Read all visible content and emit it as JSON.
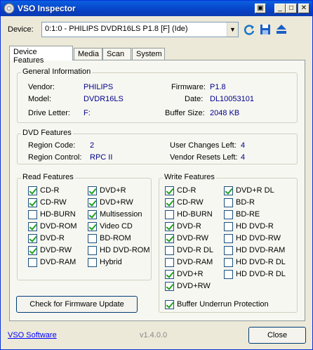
{
  "window": {
    "title": "VSO Inspector"
  },
  "device": {
    "label": "Device:",
    "selected": "0:1:0 - PHILIPS DVDR16LS P1.8 [F] (Ide)"
  },
  "tabs": [
    {
      "label": "Device Features"
    },
    {
      "label": "Media"
    },
    {
      "label": "Scan"
    },
    {
      "label": "System"
    }
  ],
  "general": {
    "title": "General Information",
    "vendor_label": "Vendor:",
    "vendor": "PHILIPS",
    "model_label": "Model:",
    "model": "DVDR16LS",
    "drive_letter_label": "Drive Letter:",
    "drive_letter": "F:",
    "firmware_label": "Firmware:",
    "firmware": "P1.8",
    "date_label": "Date:",
    "date": "DL10053101",
    "buffer_label": "Buffer Size:",
    "buffer": "2048 KB"
  },
  "dvd": {
    "title": "DVD Features",
    "region_code_label": "Region Code:",
    "region_code": "2",
    "region_control_label": "Region Control:",
    "region_control": "RPC II",
    "user_changes_label": "User Changes Left:",
    "user_changes": "4",
    "vendor_resets_label": "Vendor Resets Left:",
    "vendor_resets": "4"
  },
  "read_features": {
    "title": "Read Features",
    "items": [
      {
        "label": "CD-R",
        "checked": true
      },
      {
        "label": "DVD+R",
        "checked": true
      },
      {
        "label": "CD-RW",
        "checked": true
      },
      {
        "label": "DVD+RW",
        "checked": true
      },
      {
        "label": "HD-BURN",
        "checked": false
      },
      {
        "label": "Multisession",
        "checked": true
      },
      {
        "label": "DVD-ROM",
        "checked": true
      },
      {
        "label": "Video CD",
        "checked": true
      },
      {
        "label": "DVD-R",
        "checked": true
      },
      {
        "label": "BD-ROM",
        "checked": false
      },
      {
        "label": "DVD-RW",
        "checked": true
      },
      {
        "label": "HD DVD-ROM",
        "checked": false
      },
      {
        "label": "DVD-RAM",
        "checked": false
      },
      {
        "label": "Hybrid",
        "checked": false
      }
    ]
  },
  "write_features": {
    "title": "Write Features",
    "items": [
      {
        "label": "CD-R",
        "checked": true
      },
      {
        "label": "DVD+R DL",
        "checked": true
      },
      {
        "label": "CD-RW",
        "checked": true
      },
      {
        "label": "BD-R",
        "checked": false
      },
      {
        "label": "HD-BURN",
        "checked": false
      },
      {
        "label": "BD-RE",
        "checked": false
      },
      {
        "label": "DVD-R",
        "checked": true
      },
      {
        "label": "HD DVD-R",
        "checked": false
      },
      {
        "label": "DVD-RW",
        "checked": true
      },
      {
        "label": "HD DVD-RW",
        "checked": false
      },
      {
        "label": "DVD-R DL",
        "checked": false
      },
      {
        "label": "HD DVD-RAM",
        "checked": false
      },
      {
        "label": "DVD-RAM",
        "checked": false
      },
      {
        "label": "HD DVD-R DL",
        "checked": false
      },
      {
        "label": "DVD+R",
        "checked": true
      },
      {
        "label": "HD DVD-R DL",
        "checked": false
      },
      {
        "label": "DVD+RW",
        "checked": true
      }
    ],
    "buffer_underrun": {
      "label": "Buffer Underrun Protection",
      "checked": true
    }
  },
  "buttons": {
    "firmware_update": "Check for Firmware Update",
    "close": "Close"
  },
  "footer": {
    "link": "VSO Software",
    "version": "v1.4.0.0"
  }
}
